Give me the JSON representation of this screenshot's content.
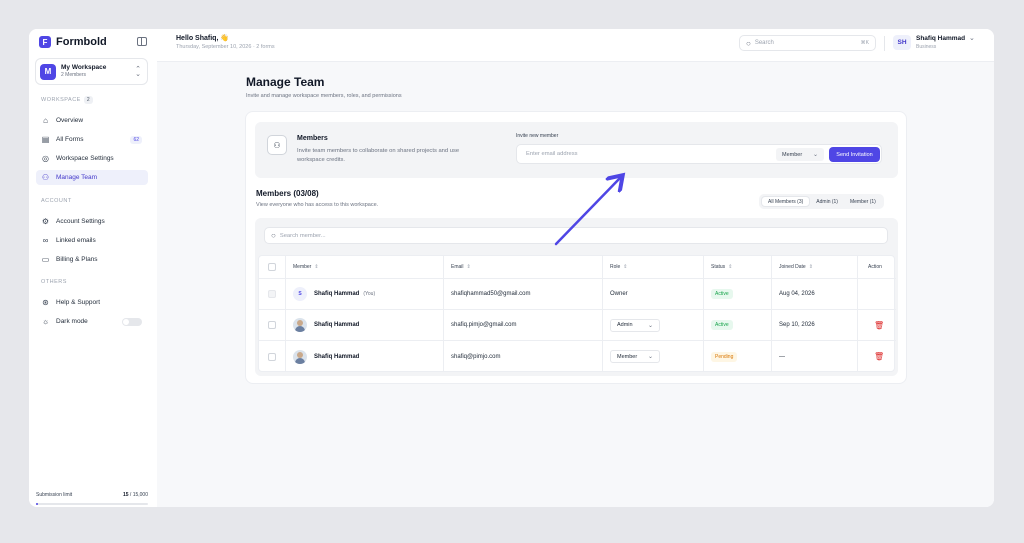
{
  "brand": {
    "name": "Formbold",
    "logo_letter": "F"
  },
  "workspace": {
    "avatar": "M",
    "name": "My Workspace",
    "members": "2 Members"
  },
  "sidebar": {
    "workspace_label": "WORKSPACE",
    "workspace_count": "2",
    "items": [
      {
        "label": "Overview",
        "icon": "home-icon"
      },
      {
        "label": "All Forms",
        "icon": "forms-icon",
        "badge": "62"
      },
      {
        "label": "Workspace Settings",
        "icon": "settings-icon"
      },
      {
        "label": "Manage Team",
        "icon": "team-icon",
        "active": true
      }
    ],
    "account_label": "ACCOUNT",
    "account_items": [
      {
        "label": "Account Settings",
        "icon": "gear-icon"
      },
      {
        "label": "Linked emails",
        "icon": "link-icon"
      },
      {
        "label": "Billing & Plans",
        "icon": "card-icon"
      }
    ],
    "others_label": "OTHERS",
    "other_items": [
      {
        "label": "Help & Support",
        "icon": "help-icon"
      },
      {
        "label": "Dark mode",
        "icon": "sun-icon"
      }
    ],
    "submission_label": "Submission limit",
    "submission_used": "15",
    "submission_total": "/ 15,000",
    "submission_fraction": 0.001
  },
  "header": {
    "greeting": "Hello Shafiq, 👋",
    "subline": "Thursday, September 10, 2026 · 2 forms",
    "search_placeholder": "Search",
    "search_shortcut": "⌘K",
    "user_initials": "SH",
    "user_name": "Shafiq Hammad",
    "user_plan": "Business"
  },
  "page": {
    "title": "Manage Team",
    "subtitle": "Invite and manage workspace members, roles, and permissions"
  },
  "invite": {
    "title": "Members",
    "description": "Invite team members to collaborate on shared projects and use workspace credits.",
    "label": "Invite new member",
    "placeholder": "Enter email address",
    "role": "Member",
    "button": "Send Invitation"
  },
  "members": {
    "title": "Members (03/08)",
    "subtitle": "View everyone who has access to this workspace.",
    "filters": [
      "All Members (3)",
      "Admin (1)",
      "Member (1)"
    ],
    "search_placeholder": "Search member...",
    "columns": [
      "Member",
      "Email",
      "Role",
      "Status",
      "Joined Date",
      "Action"
    ],
    "rows": [
      {
        "initial": "S",
        "name": "Shafiq Hammad",
        "you": "(You)",
        "email": "shafiqhammad50@gmail.com",
        "role": "Owner",
        "status": "Active",
        "joined": "Aug 04, 2026"
      },
      {
        "name": "Shafiq Hammad",
        "email": "shafiq.pimjo@gmail.com",
        "role": "Admin",
        "status": "Active",
        "joined": "Sep 10, 2026"
      },
      {
        "name": "Shafiq Hammad",
        "email": "shafiq@pimjo.com",
        "role": "Member",
        "status": "Pending",
        "joined": "—"
      }
    ]
  },
  "colors": {
    "accent": "#4f46e5",
    "active": "#16a34a",
    "pending": "#d97706",
    "danger": "#dc2626"
  }
}
